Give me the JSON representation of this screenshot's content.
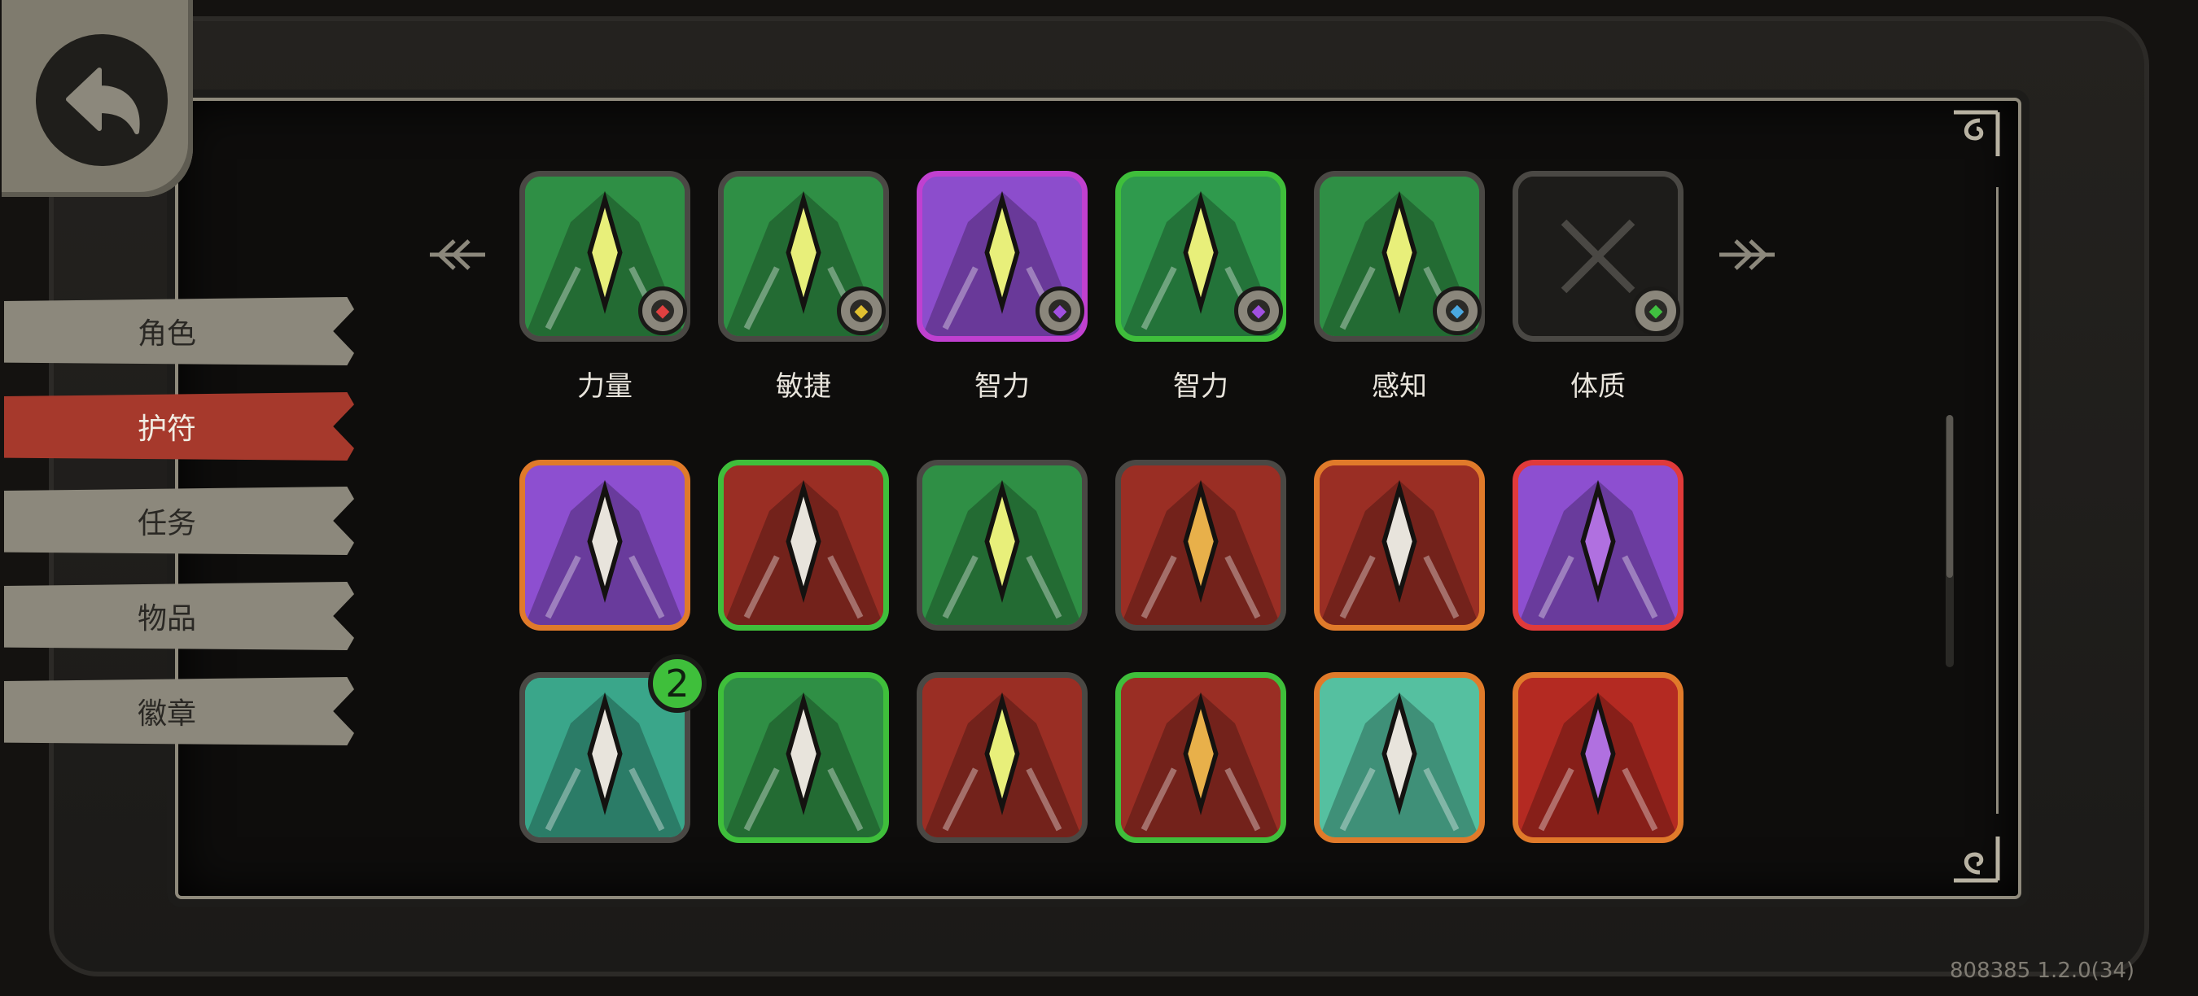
{
  "tabs": [
    {
      "label": "角色",
      "active": false
    },
    {
      "label": "护符",
      "active": true
    },
    {
      "label": "任务",
      "active": false
    },
    {
      "label": "物品",
      "active": false
    },
    {
      "label": "徽章",
      "active": false
    }
  ],
  "stat_row": [
    {
      "label": "力量",
      "border": "#4a4844",
      "bg": "#2f8f45",
      "badge_icon": "red-fist-icon",
      "badge_color": "#e04040"
    },
    {
      "label": "敏捷",
      "border": "#4a4844",
      "bg": "#2f8f45",
      "badge_icon": "yellow-chevron-icon",
      "badge_color": "#e0c030"
    },
    {
      "label": "智力",
      "border": "#c040d0",
      "bg": "#8c4dcc",
      "badge_icon": "purple-swirl-icon",
      "badge_color": "#a050e0"
    },
    {
      "label": "智力",
      "border": "#3fbf3b",
      "bg": "#2f9a4d",
      "badge_icon": "purple-swirl-icon",
      "badge_color": "#a050e0"
    },
    {
      "label": "感知",
      "border": "#4a4844",
      "bg": "#2f8f45",
      "badge_icon": "blue-star-icon",
      "badge_color": "#4aa8e0"
    },
    {
      "label": "体质",
      "border": "#4a4844",
      "bg": "#1d1c1a",
      "badge_icon": "green-shield-icon",
      "badge_color": "#40c040",
      "empty": true
    }
  ],
  "charm_rows": [
    [
      {
        "name": "ladder-charm-icon",
        "border": "#e07a2a",
        "bg": "#8d4fd0"
      },
      {
        "name": "dagger-charm-icon",
        "border": "#3fbf3b",
        "bg": "#9a2e24"
      },
      {
        "name": "green-mask-charm-icon",
        "border": "#4a4844",
        "bg": "#2f8f45"
      },
      {
        "name": "bullet-charm-icon",
        "border": "#4a4844",
        "bg": "#9a2e24"
      },
      {
        "name": "shield-orb-charm-icon",
        "border": "#e07a2a",
        "bg": "#9a2e24"
      },
      {
        "name": "purple-crescent-charm-icon",
        "border": "#e03a3a",
        "bg": "#8d4fd0"
      }
    ],
    [
      {
        "name": "golden-arrow-charm-icon",
        "border": "#4a4844",
        "bg": "#3aa68a",
        "count": "2"
      },
      {
        "name": "red-arrowhead-charm-icon",
        "border": "#3fbf3b",
        "bg": "#2f8f45"
      },
      {
        "name": "claw-charm-icon",
        "border": "#4a4844",
        "bg": "#9a2e24"
      },
      {
        "name": "demon-charm-icon",
        "border": "#3fbf3b",
        "bg": "#9a2e24"
      },
      {
        "name": "ammo-charm-icon",
        "border": "#e07a2a",
        "bg": "#55c0a0"
      },
      {
        "name": "fang-charm-icon",
        "border": "#e07a2a",
        "bg": "#b42a22"
      }
    ]
  ],
  "version_text": "808385 1.2.0(34)"
}
